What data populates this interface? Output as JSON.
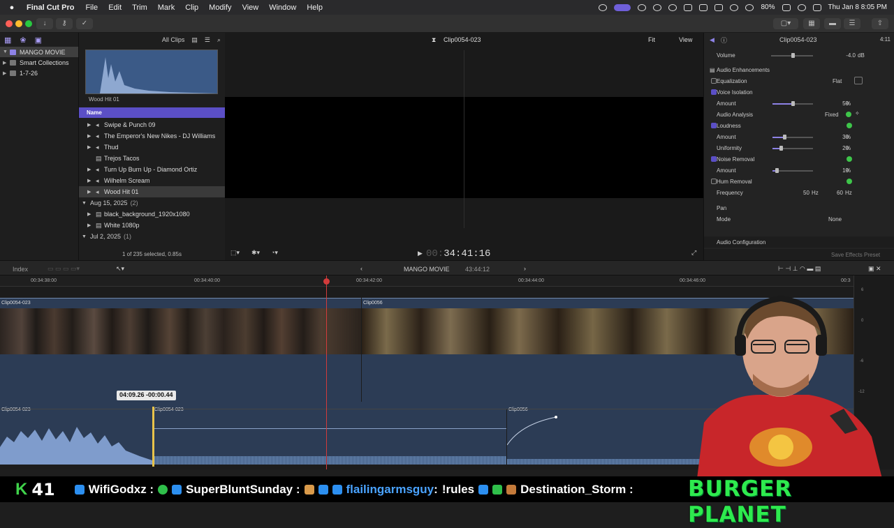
{
  "menubar": {
    "app": "Final Cut Pro",
    "items": [
      "File",
      "Edit",
      "Trim",
      "Mark",
      "Clip",
      "Modify",
      "View",
      "Window",
      "Help"
    ],
    "battery": "80%",
    "clock": "Thu Jan 8  8:05 PM"
  },
  "library": {
    "name": "MANGO MOVIE",
    "items": [
      "Smart Collections",
      "1-7-26"
    ]
  },
  "browser": {
    "filter": "All Clips",
    "filmstrip_label": "Wood Hit 01",
    "column_name": "Name",
    "rows": [
      {
        "name": "Swipe & Punch 09"
      },
      {
        "name": "The Emperor's New Nikes - DJ Williams"
      },
      {
        "name": "Thud"
      },
      {
        "name": "Trejos Tacos"
      },
      {
        "name": "Turn Up Burn Up - Diamond Ortiz"
      },
      {
        "name": "Wilhelm Scream"
      },
      {
        "name": "Wood Hit 01"
      }
    ],
    "groups": [
      {
        "date": "Aug 15, 2025",
        "count": "(2)",
        "rows": [
          "black_background_1920x1080",
          "White 1080p"
        ]
      },
      {
        "date": "Jul 2, 2025",
        "count": "(1)"
      }
    ],
    "footer": "1 of 235 selected, 0.85s"
  },
  "viewer": {
    "clip_name": "Clip0054-023",
    "fit": "Fit",
    "view": "View",
    "timecode_dim": "00:",
    "timecode": "34:41:16"
  },
  "inspector": {
    "clip_name": "Clip0054-023",
    "duration": "4:11",
    "volume_label": "Volume",
    "volume_value": "-4.0",
    "volume_unit": "dB",
    "audio_enh": "Audio Enhancements",
    "equalization": "Equalization",
    "eq_value": "Flat",
    "voice_isolation": "Voice Isolation",
    "amount": "Amount",
    "vi_amount": "50",
    "audio_analysis": "Audio Analysis",
    "fixed": "Fixed",
    "loudness": "Loudness",
    "loud_amount": "30",
    "uniformity": "Uniformity",
    "uniformity_value": "20",
    "noise_removal": "Noise Removal",
    "noise_amount": "10",
    "hum_removal": "Hum Removal",
    "frequency": "Frequency",
    "freq_50": "50",
    "freq_60": "60",
    "hz": "Hz",
    "pct": "%",
    "pan": "Pan",
    "mode": "Mode",
    "mode_value": "None",
    "audio_config": "Audio Configuration",
    "save_preset": "Save Effects Preset",
    "levels": {
      "vi": 0.5,
      "loud": 0.3,
      "uniformity": 0.2,
      "noise": 0.1
    }
  },
  "timeline": {
    "index": "Index",
    "project": "MANGO MOVIE",
    "duration": "43:44:12",
    "ruler": [
      "00:34:38:00",
      "00:34:40:00",
      "00:34:42:00",
      "00:34:44:00",
      "00:34:46:00",
      "00:3"
    ],
    "clip_a": "Clip0054-023",
    "clip_b": "Clip0056",
    "clip_a_low": "Clip0054-023",
    "clip_a_low2": "Clip0054-023",
    "clip_b_low": "Clip0056",
    "trim_tooltip": "04:09.26  -00:00.44",
    "meter": [
      "6",
      "0",
      "-6",
      "-12"
    ]
  },
  "ticker": {
    "k": "K",
    "count": "41",
    "names": [
      "WifiGodxz :",
      "SuperBluntSunday :",
      "flailingarmsguy",
      ":",
      "!rules",
      "Destination_Storm :"
    ],
    "banner": "BURGER PLANET"
  }
}
